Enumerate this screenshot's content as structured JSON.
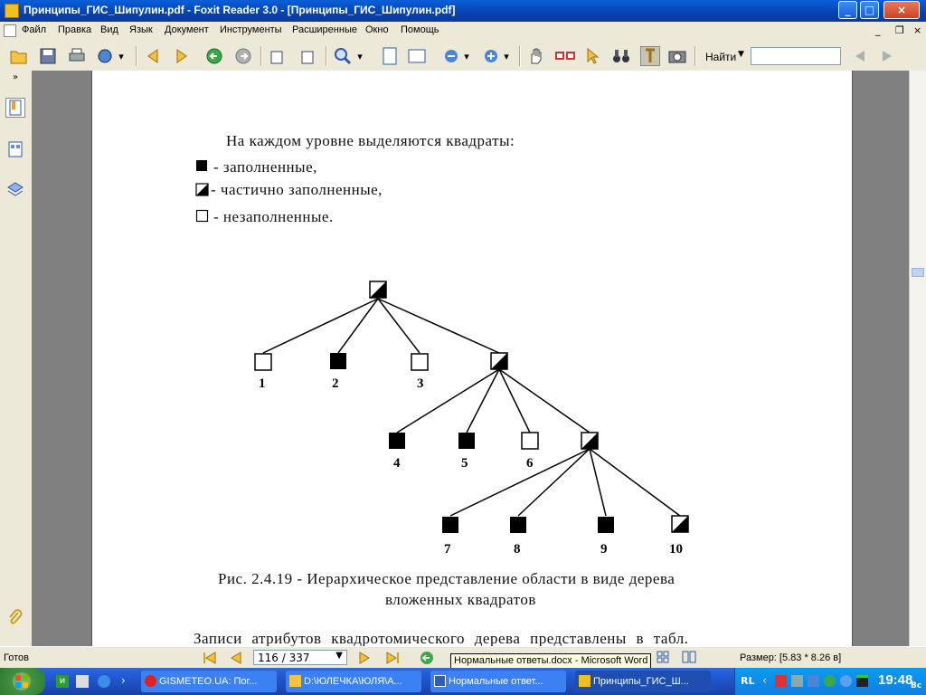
{
  "window": {
    "title": "Принципы_ГИС_Шипулин.pdf - Foxit Reader 3.0 - [Принципы_ГИС_Шипулин.pdf]",
    "minimize": "_",
    "maximize": "□",
    "close": "×"
  },
  "menu": [
    "Файл",
    "Правка",
    "Вид",
    "Язык",
    "Документ",
    "Инструменты",
    "Расширенные",
    "Окно",
    "Помощь"
  ],
  "toolbar": {
    "find_label": "Найти",
    "find_value": ""
  },
  "document": {
    "intro": "На каждом уровне выделяются квадраты:",
    "legend": [
      {
        "symbol": "filled",
        "text": "- заполненные,"
      },
      {
        "symbol": "half",
        "text": "- частично заполненные,"
      },
      {
        "symbol": "empty",
        "text": "- незаполненные."
      }
    ],
    "tree_labels": [
      "1",
      "2",
      "3",
      "4",
      "5",
      "6",
      "7",
      "8",
      "9",
      "10"
    ],
    "caption_line1": "Рис. 2.4.19 - Иерархическое представление области в виде дерева",
    "caption_line2": "вложенных квадратов",
    "bottom_text": "Записи атрибутов квадротомического дерева представлены в табл."
  },
  "status": {
    "ready": "Готов",
    "page": "116 / 337",
    "size": "Размер: [5.83 * 8.26 в]",
    "tooltip": "Нормальные ответы.docx - Microsoft Word"
  },
  "taskbar": {
    "tasks": [
      {
        "label": "GISMETEO.UA: Пог..."
      },
      {
        "label": "D:\\ЮЛЕЧКА\\ЮЛЯ\\А..."
      },
      {
        "label": "Нормальные ответ..."
      },
      {
        "label": "Принципы_ГИС_Ш..."
      }
    ],
    "lang": "RL",
    "time": "19:48",
    "day": "Вс"
  },
  "colors": {
    "titlebar": "#0842b0",
    "taskbar": "#245edb",
    "tray": "#0f7de0"
  }
}
